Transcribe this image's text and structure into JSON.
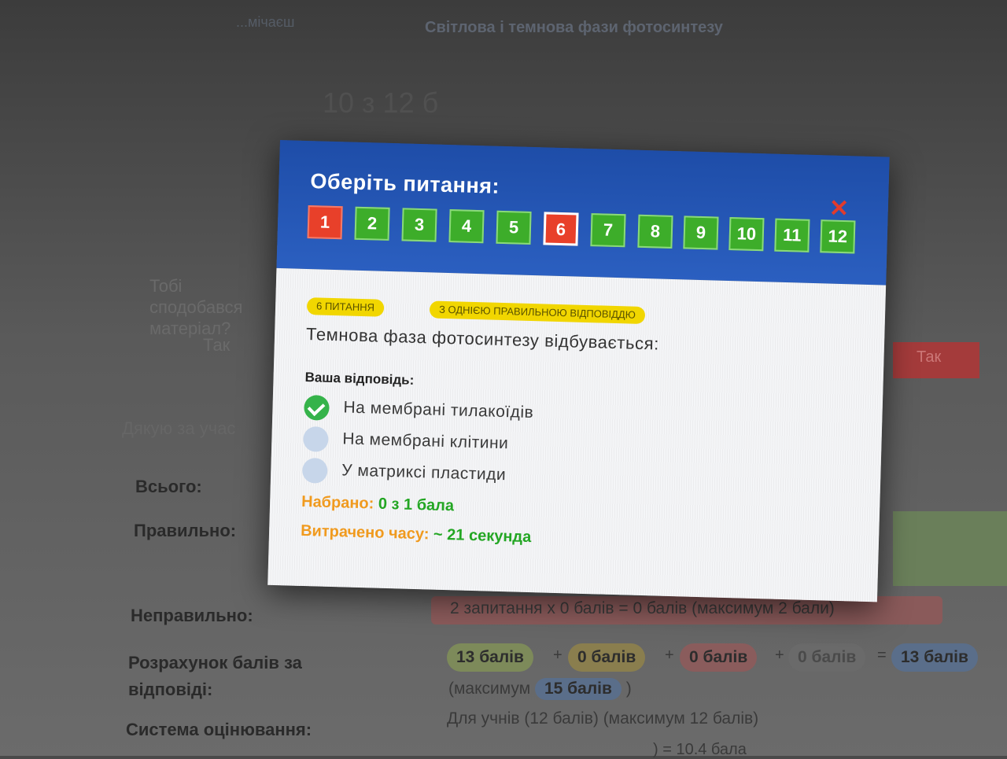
{
  "background": {
    "crumb_prev": "...мічаєш",
    "crumb": "Світлова і темнова фази фотосинтезу",
    "big_title": "10 з 12 б",
    "like_question": "Тобі сподобався матеріал?",
    "yes_label": "Так",
    "red_button_label": "Так",
    "thanks": "Дякую за учас",
    "labels": {
      "total": "Всього:",
      "correct": "Правильно:",
      "wrong": "Неправильно:",
      "calc": "Розрахунок балів за відповіді:",
      "system": "Система оцінювання:"
    },
    "wrong_value": "2 запитання x 0 балів = 0 балів (максимум 2 бали)",
    "calc_pills": [
      "13 балів",
      "0 балів",
      "0 балів",
      "0 балів",
      "13 балів"
    ],
    "calc_ops": [
      "+",
      "+",
      "+",
      "="
    ],
    "max_prefix": "(максимум",
    "max_value": "15 балів",
    "max_suffix": ")",
    "system_value": "Для учнів (12 балів) (максимум 12 балів)",
    "formula": ") = 10.4 бала"
  },
  "modal": {
    "title": "Оберіть питання:",
    "close_symbol": "✕",
    "questions": [
      {
        "num": "1",
        "state": "wrong"
      },
      {
        "num": "2",
        "state": "correct"
      },
      {
        "num": "3",
        "state": "correct"
      },
      {
        "num": "4",
        "state": "correct"
      },
      {
        "num": "5",
        "state": "correct"
      },
      {
        "num": "6",
        "state": "current"
      },
      {
        "num": "7",
        "state": "correct"
      },
      {
        "num": "8",
        "state": "correct"
      },
      {
        "num": "9",
        "state": "correct"
      },
      {
        "num": "10",
        "state": "correct"
      },
      {
        "num": "11",
        "state": "correct"
      },
      {
        "num": "12",
        "state": "correct"
      }
    ],
    "tag_question": "6 ПИТАННЯ",
    "tag_type": "З ОДНІЄЮ ПРАВИЛЬНОЮ ВІДПОВІДДЮ",
    "question_text": "Темнова фаза фотосинтезу відбувається:",
    "your_answer_label": "Ваша відповідь:",
    "options": [
      {
        "text": "На мембрані тилакоїдів",
        "selected": true
      },
      {
        "text": "На мембрані клітини",
        "selected": false
      },
      {
        "text": "У матриксі пластиди",
        "selected": false
      }
    ],
    "score_label": "Набрано:",
    "score_value": "0 з 1 бала",
    "time_label": "Витрачено часу:",
    "time_value": "~ 21 секунда"
  },
  "colors": {
    "header_blue": "#2b5fc0",
    "button_green": "#3dad2a",
    "button_red": "#e8402a",
    "tag_yellow": "#f1d600",
    "label_orange": "#f09a1e",
    "value_green": "#23a623"
  }
}
